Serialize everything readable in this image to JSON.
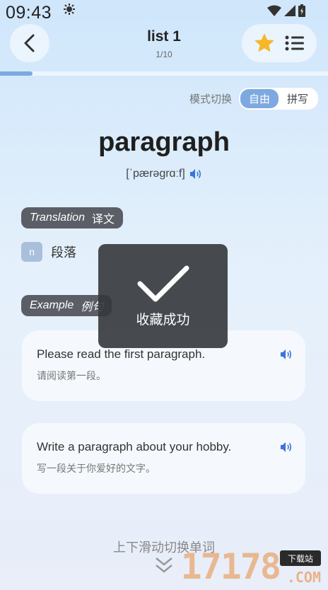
{
  "status_bar": {
    "time": "09:43"
  },
  "header": {
    "title": "list 1",
    "progress": "1/10",
    "progress_fraction": 0.1
  },
  "mode": {
    "label": "模式切换",
    "options": [
      "自由",
      "拼写"
    ],
    "active": 0
  },
  "word": {
    "text": "paragraph",
    "phonetic": "[ˈpærəɡrɑːf]"
  },
  "translation": {
    "tag_en": "Translation",
    "tag_cn": "译文",
    "pos": "n",
    "meaning": "段落"
  },
  "example": {
    "tag_en": "Example",
    "tag_cn": "例句",
    "items": [
      {
        "en": "Please read the first paragraph.",
        "cn": "请阅读第一段。"
      },
      {
        "en": "Write a paragraph about your hobby.",
        "cn": "写一段关于你爱好的文字。"
      }
    ]
  },
  "toast": {
    "text": "收藏成功",
    "icon": "check-icon"
  },
  "footer": {
    "hint": "上下滑动切换单词"
  },
  "watermark": {
    "digits": "17178",
    "badge": "下载站",
    "suffix": ".COM"
  },
  "colors": {
    "accent": "#7da9e0",
    "star": "#f5b829",
    "tag_bg": "#5b5e66",
    "sound": "#3b74d8"
  }
}
